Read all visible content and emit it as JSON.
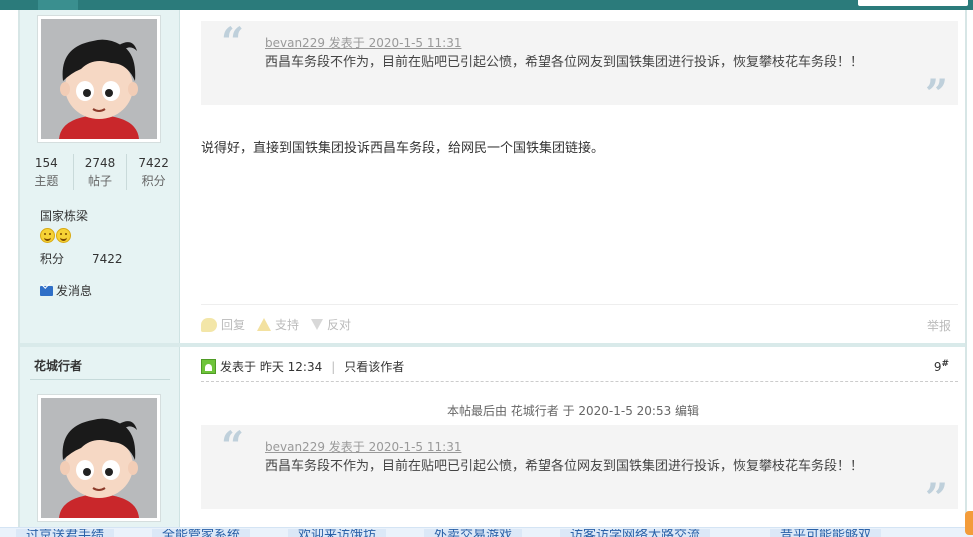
{
  "post1": {
    "author_stats": [
      {
        "value": "154",
        "label": "主题"
      },
      {
        "value": "2748",
        "label": "帖子"
      },
      {
        "value": "7422",
        "label": "积分"
      }
    ],
    "rank_title": "国家栋梁",
    "points_label": "积分",
    "points_value": "7422",
    "send_message": "发消息",
    "quote": {
      "header": "bevan229 发表于 2020-1-5 11:31",
      "body": "西昌车务段不作为，目前在贴吧已引起公愤，希望各位网友到国铁集团进行投诉，恢复攀枝花车务段！！"
    },
    "reply_text": "说得好，直接到国铁集团投诉西昌车务段，给网民一个国铁集团链接。",
    "actions": {
      "reply": "回复",
      "support": "支持",
      "oppose": "反对",
      "report": "举报"
    }
  },
  "post2": {
    "author_name": "花城行者",
    "posted_at": "发表于 昨天 12:34",
    "only_author": "只看该作者",
    "floor_number": "9",
    "floor_mark": "#",
    "edit_note": "本帖最后由 花城行者 于 2020-1-5 20:53 编辑",
    "quote": {
      "header": "bevan229 发表于 2020-1-5 11:31",
      "body": "西昌车务段不作为，目前在贴吧已引起公愤，希望各位网友到国铁集团进行投诉，恢复攀枝花车务段！！"
    }
  },
  "quote_marks": {
    "open": "“",
    "close": "”"
  },
  "bottom_tabs": [
    "过京送君手绩",
    "全能管家系统",
    "欢迎来访饿坊",
    "外卖交易游戏",
    "访客访学网络大路交流",
    "昔平可能能够双"
  ],
  "colors": {
    "top_bar": "#2b7b7b",
    "sidebar_bg": "#e6f3f3",
    "quote_bg": "#f4f4f4",
    "quote_mark": "#bfd0db"
  }
}
